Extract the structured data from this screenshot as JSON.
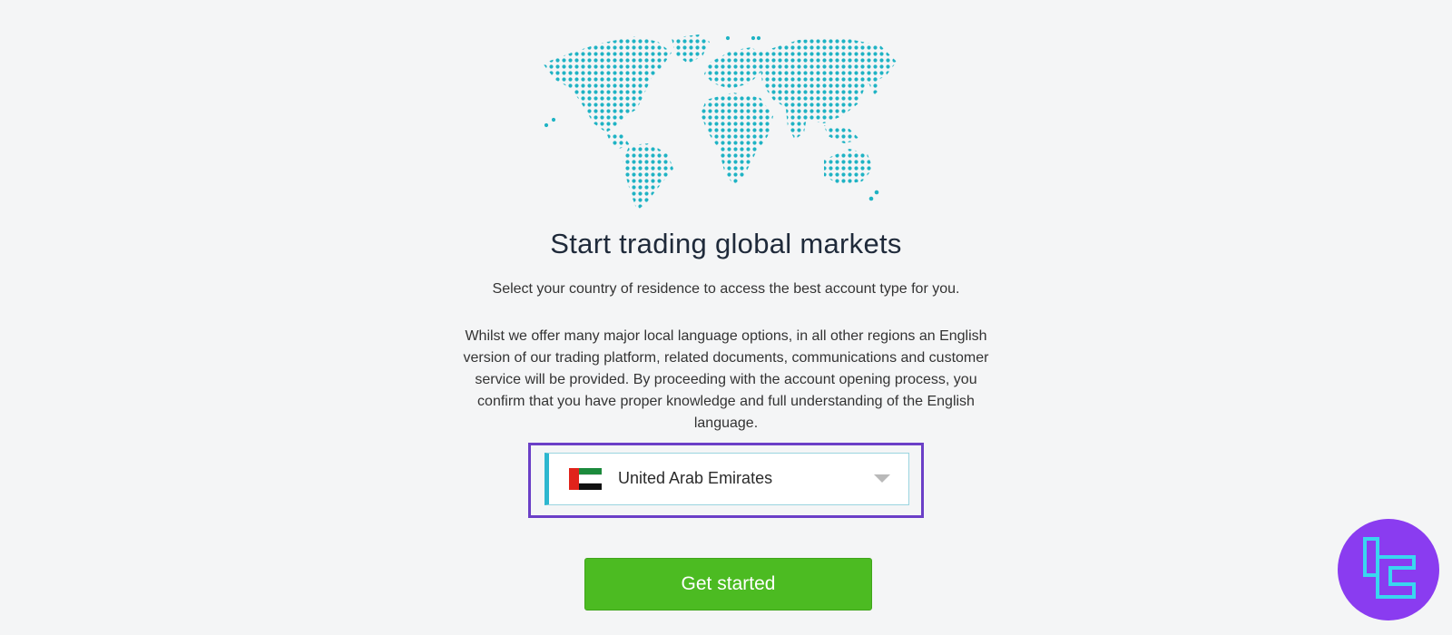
{
  "hero": {
    "title": "Start trading global markets",
    "subtitle": "Select your country of residence to access the best account type for you.",
    "disclaimer": "Whilst we offer many major local language options, in all other regions an English version of our trading platform, related documents, communications and customer service will be provided. By proceeding with the account opening process, you confirm that you have proper knowledge and full understanding of the English language."
  },
  "country_select": {
    "selected": "United Arab Emirates",
    "flag_icon": "uae-flag-icon",
    "caret_icon": "chevron-down-icon"
  },
  "cta": {
    "label": "Get started"
  },
  "colors": {
    "background": "#f4f5f6",
    "map_dots": "#1fb3c4",
    "select_accent": "#2db7cf",
    "highlight_border": "#6b3fc7",
    "cta_green": "#4cbb22",
    "logo_purple": "#8a3cf0",
    "logo_cyan": "#39d6f0"
  }
}
